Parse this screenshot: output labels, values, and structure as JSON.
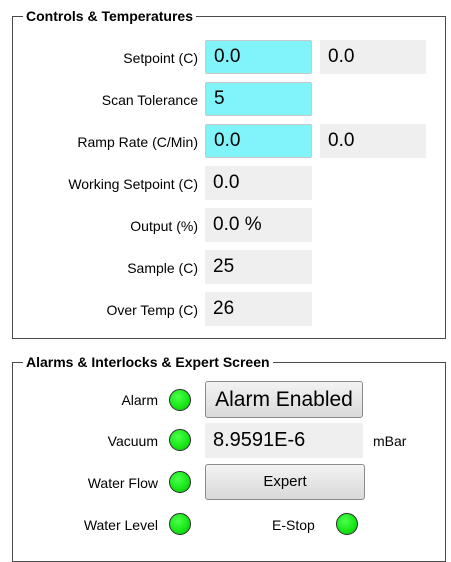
{
  "controls": {
    "title": "Controls & Temperatures",
    "setpoint": {
      "label": "Setpoint (C)",
      "input": "0.0",
      "readback": "0.0"
    },
    "scan_tolerance": {
      "label": "Scan Tolerance",
      "input": "5"
    },
    "ramp_rate": {
      "label": "Ramp Rate (C/Min)",
      "input": "0.0",
      "readback": "0.0"
    },
    "working_setpoint": {
      "label": "Working Setpoint (C)",
      "value": "0.0"
    },
    "output": {
      "label": "Output (%)",
      "value": "0.0 %"
    },
    "sample": {
      "label": "Sample (C)",
      "value": "25"
    },
    "over_temp": {
      "label": "Over Temp (C)",
      "value": "26"
    }
  },
  "alarms": {
    "title": "Alarms & Interlocks & Expert Screen",
    "alarm": {
      "label": "Alarm",
      "button": "Alarm Enabled",
      "led_color": "#18e818"
    },
    "vacuum": {
      "label": "Vacuum",
      "value": "8.9591E-6",
      "unit": "mBar",
      "led_color": "#18e818"
    },
    "water_flow": {
      "label": "Water Flow",
      "button": "Expert",
      "led_color": "#18e818"
    },
    "water_level": {
      "label": "Water Level",
      "led_color": "#18e818"
    },
    "estop": {
      "label": "E-Stop",
      "led_color": "#18e818"
    }
  }
}
